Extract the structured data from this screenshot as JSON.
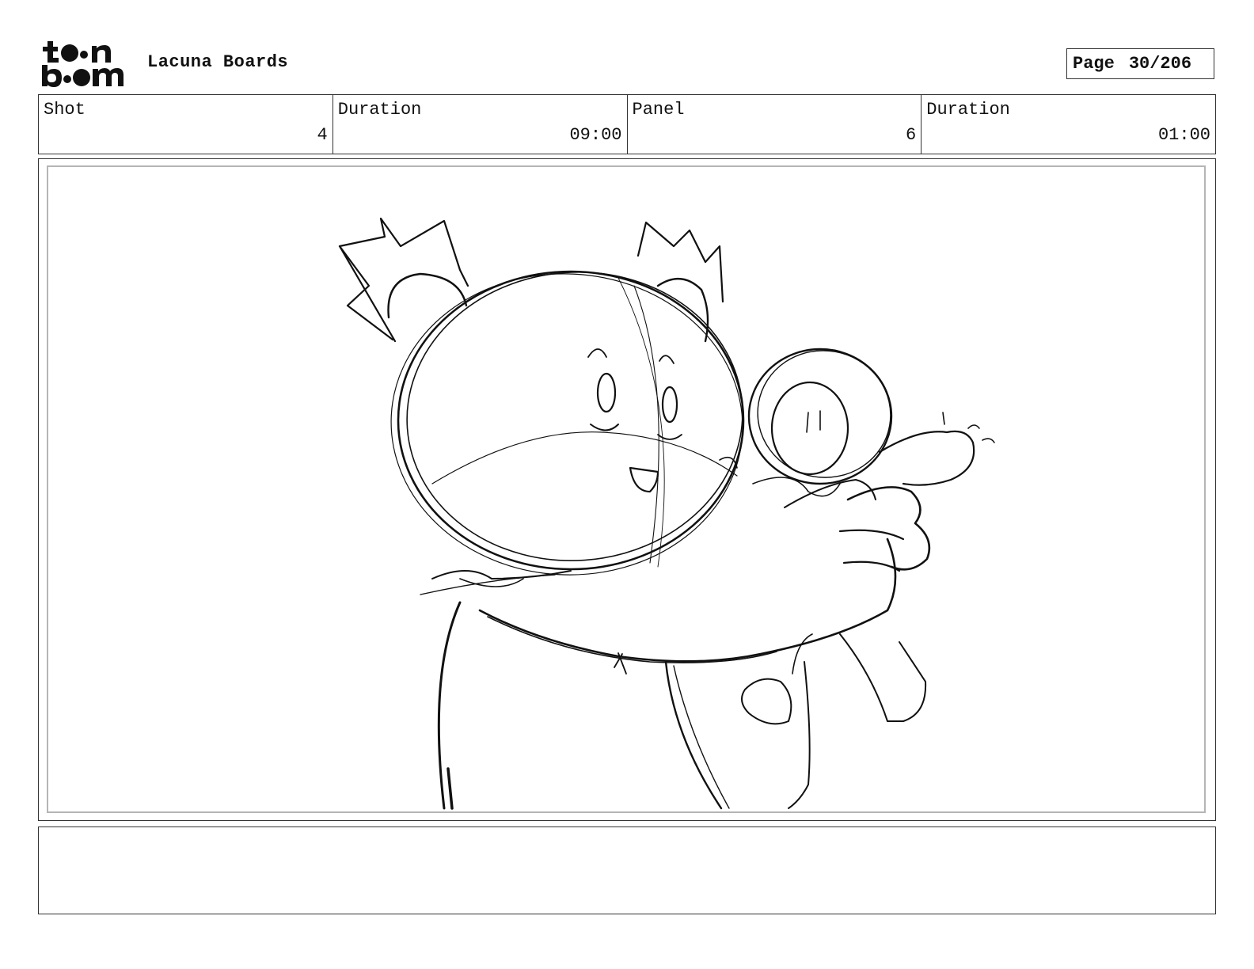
{
  "header": {
    "logo_line1": "toon",
    "logo_line2": "boom",
    "project_title": "Lacuna Boards",
    "page_label": "Page",
    "page_number": "30/206"
  },
  "info": {
    "shot_label": "Shot",
    "shot_value": "4",
    "shot_duration_label": "Duration",
    "shot_duration_value": "09:00",
    "panel_label": "Panel",
    "panel_value": "6",
    "panel_duration_label": "Duration",
    "panel_duration_value": "01:00"
  },
  "panel": {
    "image": "storyboard-sketch"
  },
  "notes": {
    "text": ""
  }
}
